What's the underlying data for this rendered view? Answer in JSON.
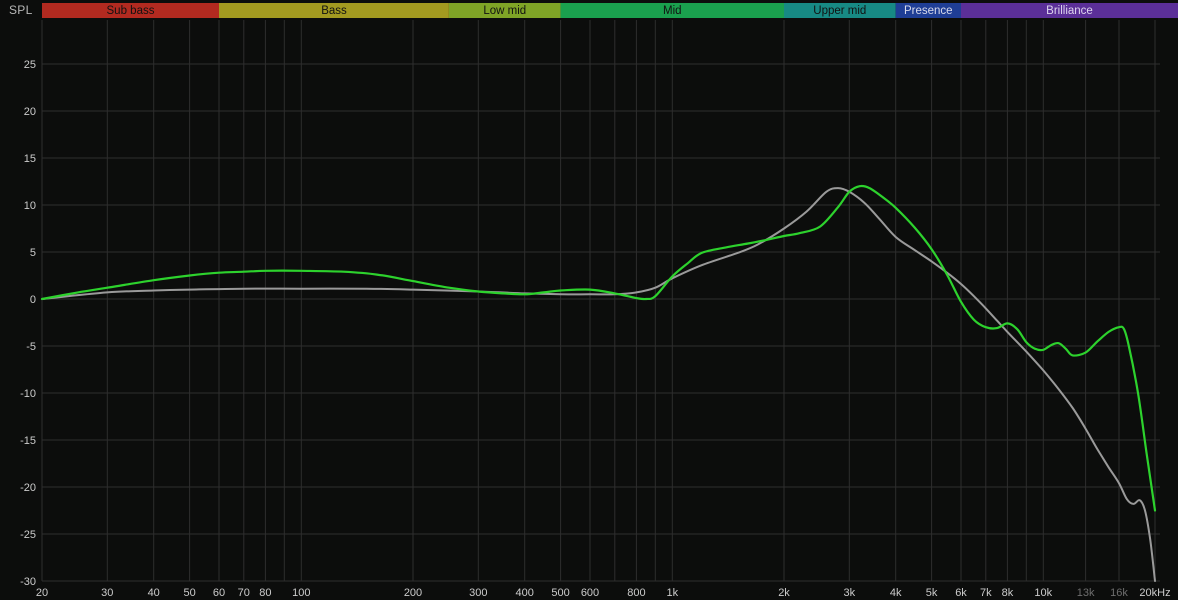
{
  "chart_data": {
    "type": "line",
    "ylabel": "SPL",
    "x_scale": "log",
    "xlim": [
      20,
      20000
    ],
    "ylim": [
      -30,
      30
    ],
    "grid": true,
    "background": "#0c0d0c",
    "grid_color": "#2e2e2e",
    "label_color": "#cccccc",
    "dim_label_color": "#6e6e6e",
    "y_ticks": [
      25,
      20,
      15,
      10,
      5,
      0,
      -5,
      -10,
      -15,
      -20,
      -25,
      -30
    ],
    "x_gridlines": [
      20,
      30,
      40,
      50,
      60,
      70,
      80,
      90,
      100,
      200,
      300,
      400,
      500,
      600,
      700,
      800,
      900,
      1000,
      2000,
      3000,
      4000,
      5000,
      6000,
      7000,
      8000,
      9000,
      10000,
      13000,
      16000,
      20000
    ],
    "x_tick_labels": [
      {
        "f": 20,
        "label": "20"
      },
      {
        "f": 30,
        "label": "30"
      },
      {
        "f": 40,
        "label": "40"
      },
      {
        "f": 50,
        "label": "50"
      },
      {
        "f": 60,
        "label": "60"
      },
      {
        "f": 70,
        "label": "70"
      },
      {
        "f": 80,
        "label": "80"
      },
      {
        "f": 100,
        "label": "100"
      },
      {
        "f": 200,
        "label": "200"
      },
      {
        "f": 300,
        "label": "300"
      },
      {
        "f": 400,
        "label": "400"
      },
      {
        "f": 500,
        "label": "500"
      },
      {
        "f": 600,
        "label": "600"
      },
      {
        "f": 800,
        "label": "800"
      },
      {
        "f": 1000,
        "label": "1k"
      },
      {
        "f": 2000,
        "label": "2k"
      },
      {
        "f": 3000,
        "label": "3k"
      },
      {
        "f": 4000,
        "label": "4k"
      },
      {
        "f": 5000,
        "label": "5k"
      },
      {
        "f": 6000,
        "label": "6k"
      },
      {
        "f": 7000,
        "label": "7k"
      },
      {
        "f": 8000,
        "label": "8k"
      },
      {
        "f": 10000,
        "label": "10k"
      },
      {
        "f": 13000,
        "label": "13k",
        "dim": true
      },
      {
        "f": 16000,
        "label": "16k",
        "dim": true
      },
      {
        "f": 20000,
        "label": "20kHz"
      }
    ],
    "bands": [
      {
        "label": "Sub bass",
        "from": 20,
        "to": 60,
        "color": "#b22a20",
        "text_color": "#121212"
      },
      {
        "label": "Bass",
        "from": 60,
        "to": 250,
        "color": "#a39a20",
        "text_color": "#121212"
      },
      {
        "label": "Low mid",
        "from": 250,
        "to": 500,
        "color": "#7fa426",
        "text_color": "#121212"
      },
      {
        "label": "Mid",
        "from": 500,
        "to": 2000,
        "color": "#1aa04e",
        "text_color": "#121212"
      },
      {
        "label": "Upper mid",
        "from": 2000,
        "to": 4000,
        "color": "#178a84",
        "text_color": "#121212"
      },
      {
        "label": "Presence",
        "from": 4000,
        "to": 6000,
        "color": "#1f3e96",
        "text_color": "#d8daec"
      },
      {
        "label": "Brilliance",
        "from": 6000,
        "to": 20000,
        "color": "#5b2f98",
        "text_color": "#ddd4ee"
      }
    ],
    "series": [
      {
        "name": "gray",
        "color": "#9a9a9a",
        "width": 2,
        "points": [
          [
            20,
            0.0
          ],
          [
            30,
            0.7
          ],
          [
            40,
            0.9
          ],
          [
            50,
            1.0
          ],
          [
            70,
            1.1
          ],
          [
            100,
            1.1
          ],
          [
            150,
            1.1
          ],
          [
            200,
            1.0
          ],
          [
            300,
            0.8
          ],
          [
            400,
            0.6
          ],
          [
            500,
            0.5
          ],
          [
            600,
            0.5
          ],
          [
            700,
            0.5
          ],
          [
            800,
            0.7
          ],
          [
            900,
            1.2
          ],
          [
            1000,
            2.2
          ],
          [
            1200,
            3.6
          ],
          [
            1500,
            4.9
          ],
          [
            1700,
            5.8
          ],
          [
            2000,
            7.5
          ],
          [
            2300,
            9.3
          ],
          [
            2600,
            11.4
          ],
          [
            2800,
            11.8
          ],
          [
            3000,
            11.4
          ],
          [
            3300,
            10.2
          ],
          [
            3600,
            8.6
          ],
          [
            4000,
            6.6
          ],
          [
            4500,
            5.2
          ],
          [
            5000,
            4.0
          ],
          [
            5500,
            2.8
          ],
          [
            6000,
            1.6
          ],
          [
            6500,
            0.3
          ],
          [
            7000,
            -1.0
          ],
          [
            7500,
            -2.3
          ],
          [
            8000,
            -3.5
          ],
          [
            9000,
            -5.6
          ],
          [
            10000,
            -7.6
          ],
          [
            11000,
            -9.6
          ],
          [
            12000,
            -11.6
          ],
          [
            13000,
            -13.8
          ],
          [
            14000,
            -16.0
          ],
          [
            15000,
            -17.9
          ],
          [
            16000,
            -19.6
          ],
          [
            16800,
            -21.3
          ],
          [
            17500,
            -21.8
          ],
          [
            18200,
            -21.4
          ],
          [
            18800,
            -22.5
          ],
          [
            19400,
            -25.5
          ],
          [
            20000,
            -30.0
          ]
        ]
      },
      {
        "name": "green",
        "color": "#2dd22d",
        "width": 2.2,
        "points": [
          [
            20,
            0.0
          ],
          [
            25,
            0.7
          ],
          [
            30,
            1.2
          ],
          [
            40,
            2.0
          ],
          [
            50,
            2.5
          ],
          [
            60,
            2.8
          ],
          [
            70,
            2.9
          ],
          [
            80,
            3.0
          ],
          [
            100,
            3.0
          ],
          [
            130,
            2.9
          ],
          [
            160,
            2.6
          ],
          [
            200,
            1.9
          ],
          [
            250,
            1.2
          ],
          [
            300,
            0.8
          ],
          [
            350,
            0.6
          ],
          [
            400,
            0.5
          ],
          [
            450,
            0.7
          ],
          [
            500,
            0.9
          ],
          [
            600,
            1.0
          ],
          [
            700,
            0.6
          ],
          [
            800,
            0.1
          ],
          [
            850,
            0.0
          ],
          [
            900,
            0.3
          ],
          [
            1000,
            2.4
          ],
          [
            1100,
            3.8
          ],
          [
            1200,
            4.9
          ],
          [
            1400,
            5.5
          ],
          [
            1600,
            5.9
          ],
          [
            1800,
            6.3
          ],
          [
            2000,
            6.7
          ],
          [
            2200,
            7.0
          ],
          [
            2500,
            7.7
          ],
          [
            2800,
            9.8
          ],
          [
            3000,
            11.4
          ],
          [
            3200,
            12.0
          ],
          [
            3400,
            11.8
          ],
          [
            3700,
            10.8
          ],
          [
            4000,
            9.7
          ],
          [
            4500,
            7.6
          ],
          [
            5000,
            5.3
          ],
          [
            5500,
            2.6
          ],
          [
            6000,
            -0.3
          ],
          [
            6500,
            -2.2
          ],
          [
            7000,
            -3.0
          ],
          [
            7500,
            -3.1
          ],
          [
            8000,
            -2.6
          ],
          [
            8500,
            -3.2
          ],
          [
            9000,
            -4.6
          ],
          [
            9500,
            -5.3
          ],
          [
            10000,
            -5.4
          ],
          [
            10500,
            -4.9
          ],
          [
            11000,
            -4.7
          ],
          [
            11500,
            -5.3
          ],
          [
            12000,
            -6.0
          ],
          [
            13000,
            -5.7
          ],
          [
            14000,
            -4.5
          ],
          [
            15000,
            -3.5
          ],
          [
            16000,
            -3.0
          ],
          [
            16500,
            -3.2
          ],
          [
            17000,
            -5.0
          ],
          [
            18000,
            -10.0
          ],
          [
            19000,
            -16.5
          ],
          [
            20000,
            -22.5
          ]
        ]
      }
    ]
  }
}
